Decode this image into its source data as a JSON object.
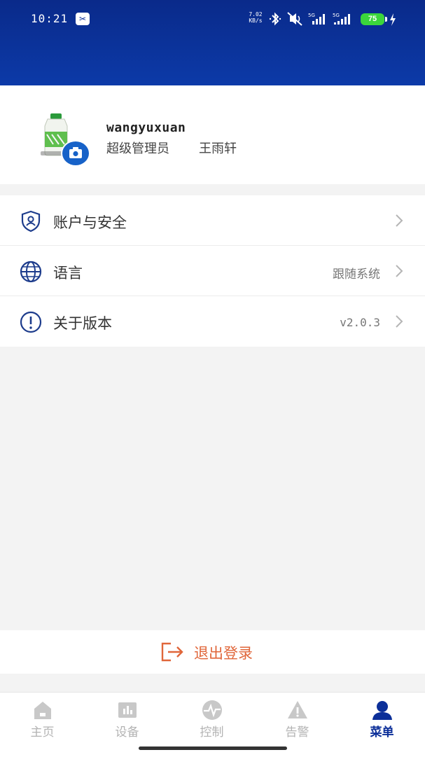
{
  "status_bar": {
    "time": "10:21",
    "net_speed_value": "7.02",
    "net_speed_unit": "KB/s",
    "signal_1_label": "5G",
    "signal_2_label": "5G",
    "battery": "75"
  },
  "profile": {
    "username": "wangyuxuan",
    "role": "超级管理员",
    "real_name": "王雨轩"
  },
  "menu": {
    "items": [
      {
        "label": "账户与安全",
        "value": "",
        "icon": "shield-user-icon"
      },
      {
        "label": "语言",
        "value": "跟随系统",
        "icon": "globe-icon"
      },
      {
        "label": "关于版本",
        "value": "v2.0.3",
        "icon": "info-icon"
      }
    ]
  },
  "logout": {
    "label": "退出登录"
  },
  "nav": {
    "items": [
      {
        "label": "主页",
        "icon": "home-icon"
      },
      {
        "label": "设备",
        "icon": "device-chart-icon"
      },
      {
        "label": "控制",
        "icon": "control-pulse-icon"
      },
      {
        "label": "告警",
        "icon": "warning-icon"
      },
      {
        "label": "菜单",
        "icon": "user-menu-icon"
      }
    ],
    "active_index": 4
  },
  "colors": {
    "header": "#0c3aa8",
    "accent": "#0c2f99",
    "logout": "#e0663a",
    "camera_badge": "#1762c8",
    "battery": "#3bd63b"
  }
}
